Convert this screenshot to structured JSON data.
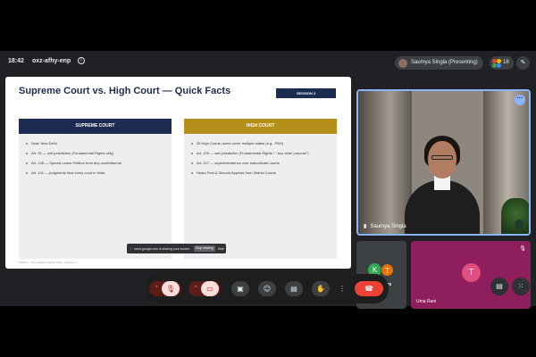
{
  "topbar": {
    "time": "18:42",
    "meeting_code": "oxz-afhy-enp",
    "presenting_label": "Saumya Singla (Presenting)",
    "participant_count": "18"
  },
  "slide": {
    "title": "Supreme Court vs. High Court — Quick Facts",
    "session_badge": "SESSION 3",
    "left_heading": "SUPREME COURT",
    "left_items": [
      "Seat: New Delhi",
      "Art. 32 — writ jurisdiction (Fundamental Rights only)",
      "Art. 136 — Special Leave Petition from any court/tribunal",
      "Art. 141 — judgments bind every court in India"
    ],
    "right_heading": "HIGH COURT",
    "right_items": [
      "25 High Courts; some cover multiple states (e.g., P&H)",
      "Art. 226 — writ jurisdiction (Fundamental Rights + \"any other purpose\")",
      "Art. 227 — superintendence over subordinate courts",
      "Hears First & Second Appeals from District Courts"
    ],
    "footer": "INDIA-2  ·  The Litigation Starter Pack  ·  Session 3"
  },
  "share_bar": {
    "text": "meet.google.com is sharing your screen.",
    "stop_label": "Stop sharing",
    "hide_label": "Hide"
  },
  "tiles": {
    "presenter_name": "Saumya Singla",
    "others_label": "15 others",
    "others_initial_1": "K",
    "others_initial_2": "T",
    "uma_initial": "T",
    "uma_name": "Uma Rani"
  },
  "icons": {
    "info": "info-icon",
    "edit": "pencil-icon",
    "mic_off": "mic-off-icon",
    "camera_off": "camera-off-icon",
    "present": "present-screen-icon",
    "emoji": "emoji-icon",
    "captions": "captions-icon",
    "raise_hand": "raise-hand-icon",
    "more": "more-vert-icon",
    "end_call": "end-call-icon",
    "chat": "chat-icon",
    "activities": "activities-icon"
  },
  "colors": {
    "accent": "#8ab4f8",
    "end_call": "#ea4335",
    "navy": "#1c2b52",
    "gold": "#b48f1b",
    "uma_tile": "#8e1e5c"
  }
}
